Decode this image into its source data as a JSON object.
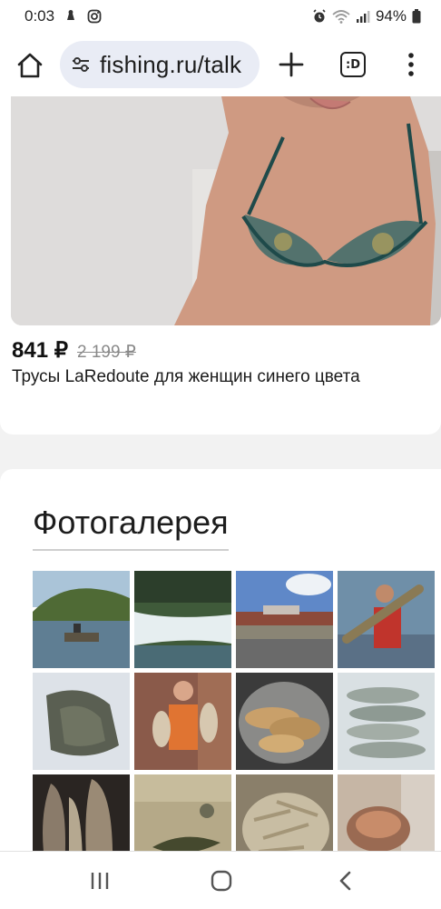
{
  "status_bar": {
    "time": "0:03",
    "battery": "94%"
  },
  "toolbar": {
    "url": "fishing.ru/talk",
    "tabs_badge": ":D"
  },
  "product": {
    "price": "841 ₽",
    "old_price": "2 199 ₽",
    "title": "Трусы LaRedoute для женщин синего цвета"
  },
  "gallery": {
    "title": "Фотогалерея",
    "photos": [
      "river-boat",
      "rapids",
      "riverside-town",
      "man-holding-pike",
      "fish-in-snow",
      "man-holding-fish",
      "fish-in-pot",
      "fish-on-ice",
      "dried-fish",
      "fish-on-ground",
      "small-fish-pile",
      "fish-in-hand"
    ]
  },
  "colors": {
    "url_pill_bg": "#e9ecf5",
    "content_bg": "#f2f2f2"
  }
}
